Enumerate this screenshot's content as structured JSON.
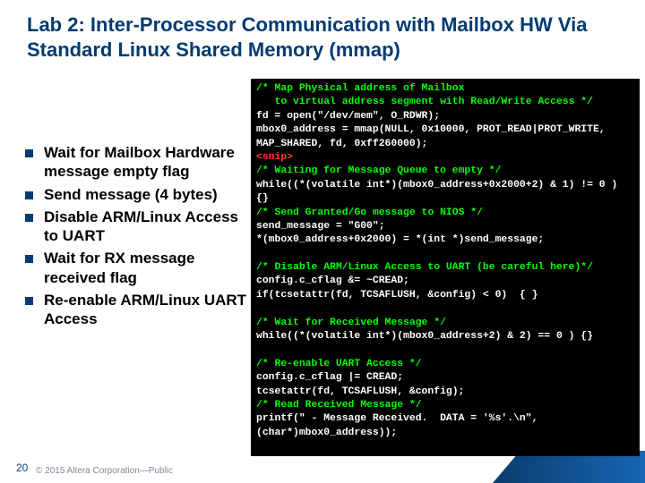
{
  "title": "Lab 2: Inter-Processor Communication with Mailbox HW Via Standard Linux Shared Memory (mmap)",
  "bullets": [
    "Wait for Mailbox Hardware message empty flag",
    "Send message (4 bytes)",
    "Disable ARM/Linux Access to UART",
    "Wait for RX message received flag",
    "Re-enable ARM/Linux UART Access"
  ],
  "code": {
    "c1": "/* Map Physical address of Mailbox",
    "c2": "   to virtual address segment with Read/Write Access */",
    "l1": "fd = open(\"/dev/mem\", O_RDWR);",
    "l2": "mbox0_address = mmap(NULL, 0x10000, PROT_READ|PROT_WRITE, MAP_SHARED, fd, 0xff260000);",
    "snip": "<snip>",
    "c3": "/* Waiting for Message Queue to empty */",
    "l3": "while((*(volatile int*)(mbox0_address+0x2000+2) & 1) != 0 ) {}",
    "c4": "/* Send Granted/Go message to NIOS */",
    "l4": "send_message = \"G00\";",
    "l5": "*(mbox0_address+0x2000) = *(int *)send_message;",
    "c5": "/* Disable ARM/Linux Access to UART (be careful here)*/",
    "l6": "config.c_cflag &= ~CREAD;",
    "l7": "if(tcsetattr(fd, TCSAFLUSH, &config) < 0)  { }",
    "c6": "/* Wait for Received Message */",
    "l8": "while((*(volatile int*)(mbox0_address+2) & 2) == 0 ) {}",
    "c7": "/* Re-enable UART Access */",
    "l9": "config.c_cflag |= CREAD;",
    "l10": "tcsetattr(fd, TCSAFLUSH, &config);",
    "c8": "/* Read Received Message */",
    "l11": "printf(\" - Message Received.  DATA = '%s'.\\n\", (char*)mbox0_address));"
  },
  "page_number": "20",
  "footer": "© 2015 Altera Corporation—Public"
}
